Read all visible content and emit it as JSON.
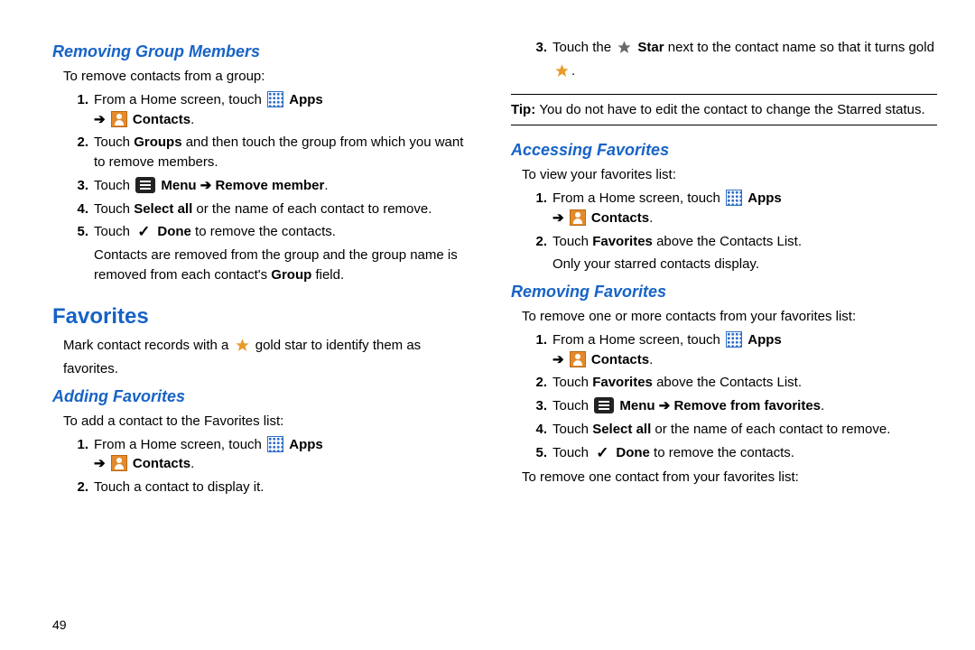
{
  "left": {
    "h1": "Removing Group Members",
    "intro": "To remove contacts from a group:",
    "steps": [
      {
        "pre": "From a Home screen, touch ",
        "apps": true,
        "apps_label": "Apps",
        "nl": true,
        "arrow": true,
        "contacts": true,
        "contacts_label": "Contacts",
        "period": true
      },
      {
        "text1": "Touch ",
        "b1": "Groups",
        "text2": " and then touch the group from which you want to remove members."
      },
      {
        "text1": "Touch ",
        "menu": true,
        "b1": "Menu",
        "arrow_bold": true,
        "b2": "Remove member",
        "period": true
      },
      {
        "text1": "Touch ",
        "b1": "Select all",
        "text2": " or the name of each contact to remove."
      },
      {
        "text1": "Touch ",
        "check": true,
        "b1": "Done",
        "text2": " to remove the contacts.",
        "after": "Contacts are removed from the group and the group name is removed from each contact's ",
        "after_b": "Group",
        "after2": " field."
      }
    ],
    "h2": "Favorites",
    "fav_intro_a": "Mark contact records with a ",
    "fav_intro_b": " gold star to identify them as favorites.",
    "h3": "Adding Favorites",
    "add_intro": "To add a contact to the Favorites list:",
    "add_steps": [
      {
        "pre": "From a Home screen, touch ",
        "apps": true,
        "apps_label": "Apps",
        "nl": true,
        "arrow": true,
        "contacts": true,
        "contacts_label": "Contacts",
        "period": true
      },
      {
        "text1": "Touch a contact to display it."
      }
    ]
  },
  "right": {
    "step3_a": "Touch the ",
    "step3_b": "Star",
    "step3_c": " next to the contact name so that it turns gold ",
    "tip_label": "Tip: ",
    "tip_text": "You do not have to edit the contact to change the Starred status.",
    "h1": "Accessing Favorites",
    "acc_intro": "To view your favorites list:",
    "acc_steps": [
      {
        "pre": "From a Home screen, touch ",
        "apps": true,
        "apps_label": "Apps",
        "nl": true,
        "arrow": true,
        "contacts": true,
        "contacts_label": "Contacts",
        "period": true
      },
      {
        "text1": "Touch ",
        "b1": "Favorites",
        "text2": " above the Contacts List.",
        "after": "Only your starred contacts display."
      }
    ],
    "h2": "Removing Favorites",
    "rem_intro": "To remove one or more contacts from your favorites list:",
    "rem_steps": [
      {
        "pre": "From a Home screen, touch ",
        "apps": true,
        "apps_label": "Apps",
        "nl": true,
        "arrow": true,
        "contacts": true,
        "contacts_label": "Contacts",
        "period": true
      },
      {
        "text1": "Touch ",
        "b1": "Favorites",
        "text2": " above the Contacts List."
      },
      {
        "text1": "Touch ",
        "menu": true,
        "b1": "Menu",
        "arrow_bold": true,
        "b2": "Remove from favorites",
        "period": true
      },
      {
        "text1": "Touch ",
        "b1": "Select all",
        "text2": " or the name of each contact to remove."
      },
      {
        "text1": "Touch ",
        "check": true,
        "b1": "Done",
        "text2": " to remove the contacts."
      }
    ],
    "rem_footer": "To remove one contact from your favorites list:"
  },
  "page_num": "49"
}
